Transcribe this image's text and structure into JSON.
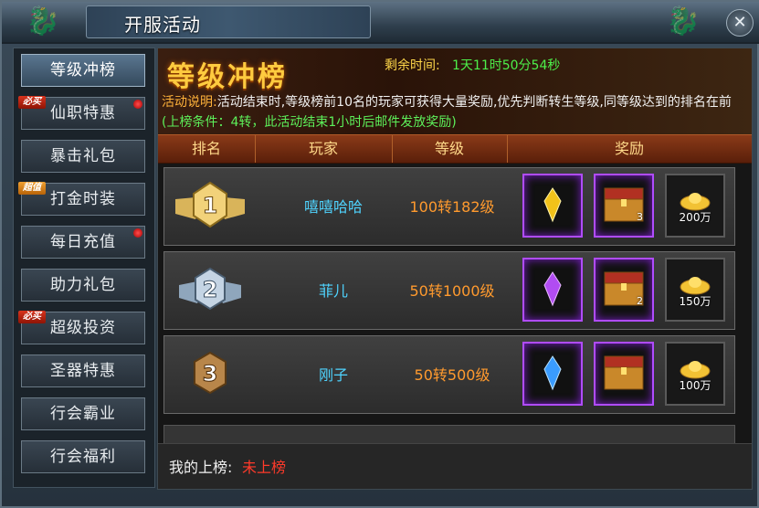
{
  "window": {
    "title": "开服活动",
    "close_icon": "close-icon"
  },
  "sidebar": {
    "items": [
      {
        "label": "等级冲榜",
        "active": true,
        "tag": "",
        "dot": false
      },
      {
        "label": "仙职特惠",
        "active": false,
        "tag": "必买",
        "dot": true
      },
      {
        "label": "暴击礼包",
        "active": false,
        "tag": "",
        "dot": false
      },
      {
        "label": "打金时装",
        "active": false,
        "tag": "超值",
        "dot": false
      },
      {
        "label": "每日充值",
        "active": false,
        "tag": "",
        "dot": true
      },
      {
        "label": "助力礼包",
        "active": false,
        "tag": "",
        "dot": false
      },
      {
        "label": "超级投资",
        "active": false,
        "tag": "必买",
        "dot": false
      },
      {
        "label": "圣器特惠",
        "active": false,
        "tag": "",
        "dot": false
      },
      {
        "label": "行会霸业",
        "active": false,
        "tag": "",
        "dot": false
      },
      {
        "label": "行会福利",
        "active": false,
        "tag": "",
        "dot": false
      }
    ]
  },
  "banner": {
    "title": "等级冲榜",
    "remaining_label": "剩余时间:",
    "remaining_value": "1天11时50分54秒",
    "desc_label": "活动说明:",
    "desc_text": "活动结束时,等级榜前10名的玩家可获得大量奖励,优先判断转生等级,同等级达到的排名在前",
    "desc_condition": "(上榜条件：4转，此活动结束1小时后邮件发放奖励)"
  },
  "table": {
    "headers": [
      "排名",
      "玩家",
      "等级",
      "奖励"
    ],
    "rows": [
      {
        "rank": "1",
        "player": "嘻嘻哈哈",
        "level": "100转182级",
        "gem_color": "#f2c21a",
        "chest_count": "3",
        "gold": "200万"
      },
      {
        "rank": "2",
        "player": "菲儿",
        "level": "50转1000级",
        "gem_color": "#b14cf2",
        "chest_count": "2",
        "gold": "150万"
      },
      {
        "rank": "3",
        "player": "刚子",
        "level": "50转500级",
        "gem_color": "#3a9cff",
        "chest_count": "",
        "gold": "100万"
      }
    ]
  },
  "footer": {
    "my_rank_label": "我的上榜:",
    "my_rank_value": "未上榜"
  },
  "colors": {
    "accent": "#ffcb3f",
    "player": "#4fd4ff",
    "level": "#ff9a2e",
    "condition": "#5df05a",
    "unranked": "#ff3a2a"
  }
}
